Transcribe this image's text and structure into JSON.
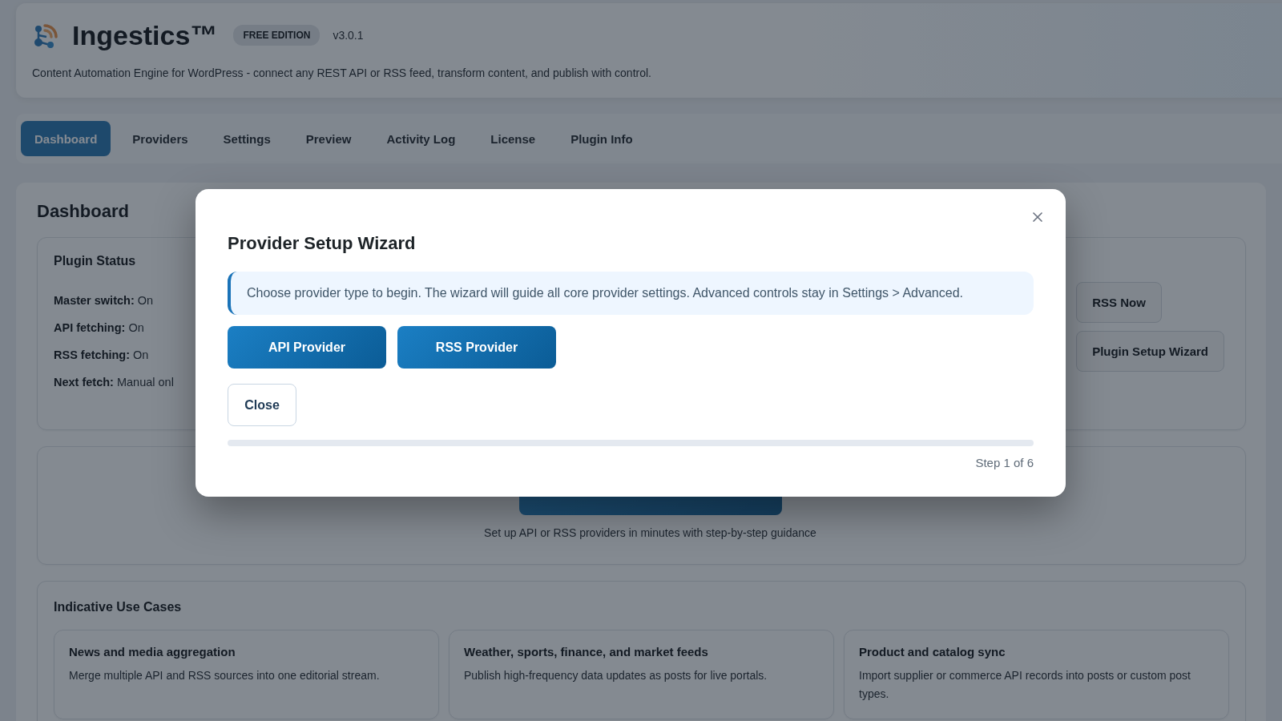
{
  "app": {
    "title": "Ingestics™",
    "edition": "FREE EDITION",
    "version": "v3.0.1",
    "tagline": "Content Automation Engine for WordPress - connect any REST API or RSS feed, transform content, and publish with control."
  },
  "tabs": [
    {
      "label": "Dashboard",
      "selected": true
    },
    {
      "label": "Providers",
      "selected": false
    },
    {
      "label": "Settings",
      "selected": false
    },
    {
      "label": "Preview",
      "selected": false
    },
    {
      "label": "Activity Log",
      "selected": false
    },
    {
      "label": "License",
      "selected": false
    },
    {
      "label": "Plugin Info",
      "selected": false
    }
  ],
  "dashboard": {
    "title": "Dashboard",
    "status_card": {
      "title": "Plugin Status",
      "items": [
        "**Master switch:** On",
        "**API fetching:** On",
        "**RSS fetching:** On",
        "**Next fetch:** Manual onl"
      ]
    },
    "actions": [
      "RSS Now",
      "Plugin Setup Wizard"
    ],
    "wizard_card": {
      "caption": "Set up API or RSS providers in minutes with step-by-step guidance"
    },
    "use_cases": {
      "title": "Indicative Use Cases",
      "items": [
        {
          "title": "News and media aggregation",
          "description": "Merge multiple API and RSS sources into one editorial stream."
        },
        {
          "title": "Weather, sports, finance, and market feeds",
          "description": "Publish high-frequency data updates as posts for live portals."
        },
        {
          "title": "Product and catalog sync",
          "description": "Import supplier or commerce API records into posts or custom post types."
        }
      ]
    }
  },
  "modal": {
    "title": "Provider Setup Wizard",
    "notice": "Choose provider type to begin. The wizard will guide all core provider settings. Advanced controls stay in Settings > Advanced.",
    "choices": [
      "API Provider",
      "RSS Provider"
    ],
    "close_label": "Close",
    "step": "Step 1 of 6"
  }
}
